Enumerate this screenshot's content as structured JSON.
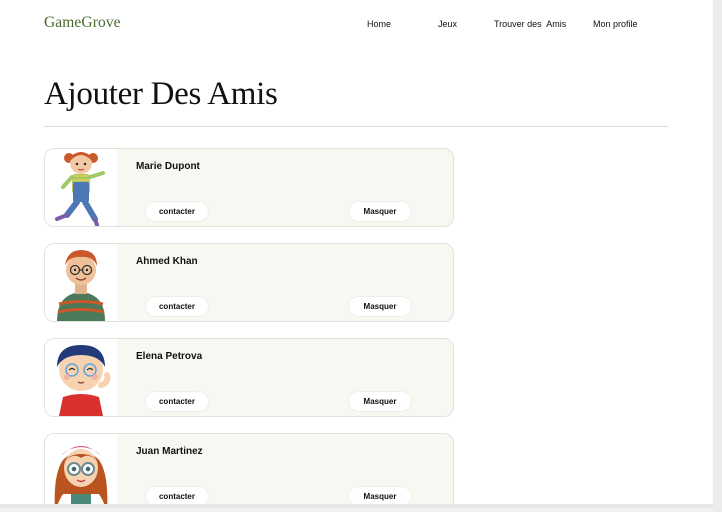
{
  "brand": {
    "logo": "GameGrove",
    "accent": "#4b6b2a"
  },
  "nav": {
    "home": "Home",
    "games": "Jeux",
    "find_friends": "Trouver des  Amis",
    "profile": "Mon profile"
  },
  "page": {
    "title": "Ajouter Des Amis"
  },
  "friends": [
    {
      "name": "Marie Dupont",
      "contact": "contacter",
      "hide": "Masquer",
      "avatar": "girl-pigtails-avatar"
    },
    {
      "name": "Ahmed Khan",
      "contact": "contacter",
      "hide": "Masquer",
      "avatar": "boy-glasses-avatar"
    },
    {
      "name": "Elena Petrova",
      "contact": "contacter",
      "hide": "Masquer",
      "avatar": "girl-blue-hair-avatar"
    },
    {
      "name": "Juan Martinez",
      "contact": "contacter",
      "hide": "Masquer",
      "avatar": "girl-red-hair-glasses-avatar"
    }
  ]
}
